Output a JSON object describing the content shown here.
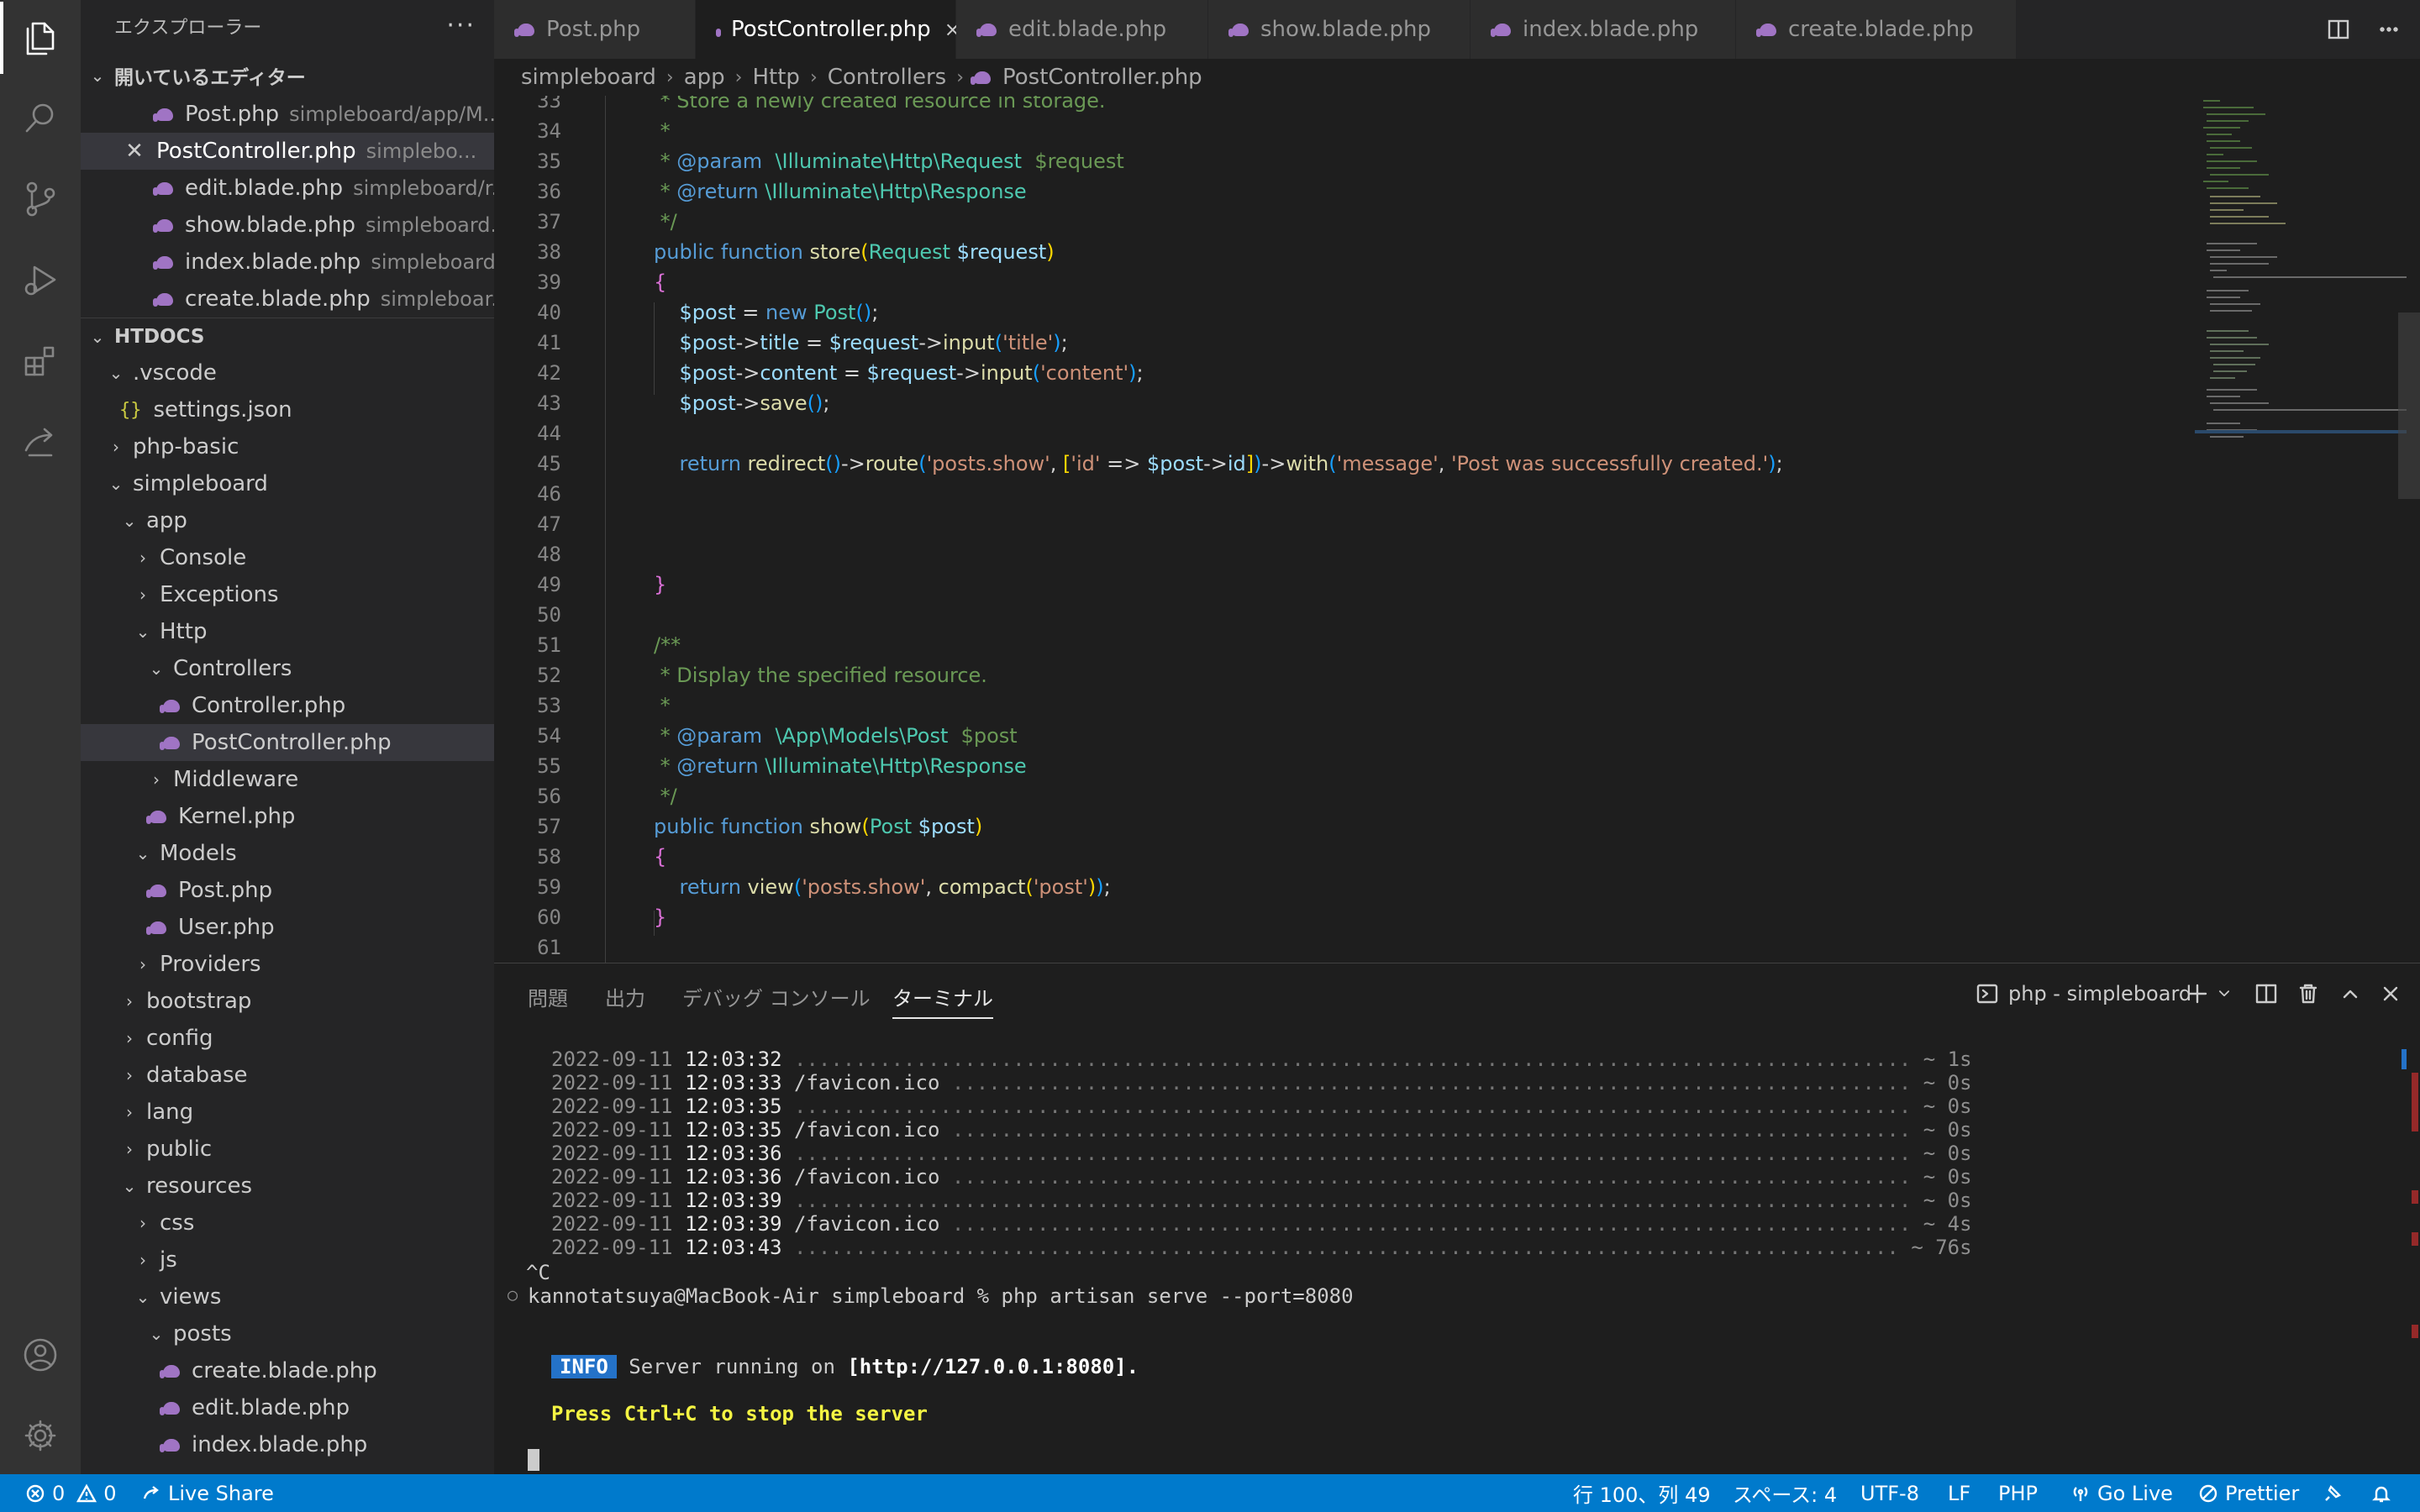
{
  "sidebar": {
    "title": "エクスプローラー",
    "more": "···",
    "open_editors_header": "開いているエディター",
    "open_editors": [
      {
        "name": "Post.php",
        "path": "simpleboard/app/M..."
      },
      {
        "name": "PostController.php",
        "path": "simplebo..."
      },
      {
        "name": "edit.blade.php",
        "path": "simpleboard/r..."
      },
      {
        "name": "show.blade.php",
        "path": "simpleboard..."
      },
      {
        "name": "index.blade.php",
        "path": "simpleboard..."
      },
      {
        "name": "create.blade.php",
        "path": "simpleboar..."
      }
    ],
    "workspace_header": "HTDOCS",
    "tree": [
      {
        "label": ".vscode"
      },
      {
        "label": "settings.json"
      },
      {
        "label": "php-basic"
      },
      {
        "label": "simpleboard"
      },
      {
        "label": "app"
      },
      {
        "label": "Console"
      },
      {
        "label": "Exceptions"
      },
      {
        "label": "Http"
      },
      {
        "label": "Controllers"
      },
      {
        "label": "Controller.php"
      },
      {
        "label": "PostController.php"
      },
      {
        "label": "Middleware"
      },
      {
        "label": "Kernel.php"
      },
      {
        "label": "Models"
      },
      {
        "label": "Post.php"
      },
      {
        "label": "User.php"
      },
      {
        "label": "Providers"
      },
      {
        "label": "bootstrap"
      },
      {
        "label": "config"
      },
      {
        "label": "database"
      },
      {
        "label": "lang"
      },
      {
        "label": "public"
      },
      {
        "label": "resources"
      },
      {
        "label": "css"
      },
      {
        "label": "js"
      },
      {
        "label": "views"
      },
      {
        "label": "posts"
      },
      {
        "label": "create.blade.php"
      },
      {
        "label": "edit.blade.php"
      },
      {
        "label": "index.blade.php"
      }
    ]
  },
  "tabs": [
    {
      "label": "Post.php"
    },
    {
      "label": "PostController.php"
    },
    {
      "label": "edit.blade.php"
    },
    {
      "label": "show.blade.php"
    },
    {
      "label": "index.blade.php"
    },
    {
      "label": "create.blade.php"
    }
  ],
  "tab_close": "×",
  "breadcrumb": [
    "simpleboard",
    "app",
    "Http",
    "Controllers",
    "PostController.php"
  ],
  "editor": {
    "line_numbers": [
      "33",
      "34",
      "35",
      "36",
      "37",
      "38",
      "39",
      "40",
      "41",
      "42",
      "43",
      "44",
      "45",
      "46",
      "47",
      "48",
      "49",
      "50",
      "51",
      "52",
      "53",
      "54",
      "55",
      "56",
      "57",
      "58",
      "59",
      "60",
      "61"
    ]
  },
  "panel": {
    "tabs": [
      "問題",
      "出力",
      "デバッグ コンソール",
      "ターミナル"
    ],
    "terminal_name": "php - simpleboard",
    "log": [
      {
        "date": "2022-09-11",
        "time": "12:03:32",
        "path": "",
        "duration": "~ 1s"
      },
      {
        "date": "2022-09-11",
        "time": "12:03:33",
        "path": "/favicon.ico",
        "duration": "~ 0s"
      },
      {
        "date": "2022-09-11",
        "time": "12:03:35",
        "path": "",
        "duration": "~ 0s"
      },
      {
        "date": "2022-09-11",
        "time": "12:03:35",
        "path": "/favicon.ico",
        "duration": "~ 0s"
      },
      {
        "date": "2022-09-11",
        "time": "12:03:36",
        "path": "",
        "duration": "~ 0s"
      },
      {
        "date": "2022-09-11",
        "time": "12:03:36",
        "path": "/favicon.ico",
        "duration": "~ 0s"
      },
      {
        "date": "2022-09-11",
        "time": "12:03:39",
        "path": "",
        "duration": "~ 0s"
      },
      {
        "date": "2022-09-11",
        "time": "12:03:39",
        "path": "/favicon.ico",
        "duration": "~ 4s"
      },
      {
        "date": "2022-09-11",
        "time": "12:03:43",
        "path": "",
        "duration": "~ 76s"
      }
    ],
    "ctrl_c": "^C",
    "prompt": "kannotatsuya@MacBook-Air simpleboard % php artisan serve --port=8080",
    "info_badge": "INFO",
    "info_pre": "Server running on",
    "info_url": "[http://127.0.0.1:8080].",
    "press_msg": "Press Ctrl+C to stop the server"
  },
  "statusbar": {
    "errors": "0",
    "warnings": "0",
    "live_share": "Live Share",
    "position": "行 100、列 49",
    "spaces": "スペース: 4",
    "encoding": "UTF-8",
    "eol": "LF",
    "language": "PHP",
    "go_live": "Go Live",
    "prettier": "Prettier"
  },
  "colors": {
    "accent": "#007acc",
    "php_icon": "#a074c4",
    "activity_bar": "#333333",
    "sidebar": "#252526",
    "editor": "#1e1e1e"
  }
}
